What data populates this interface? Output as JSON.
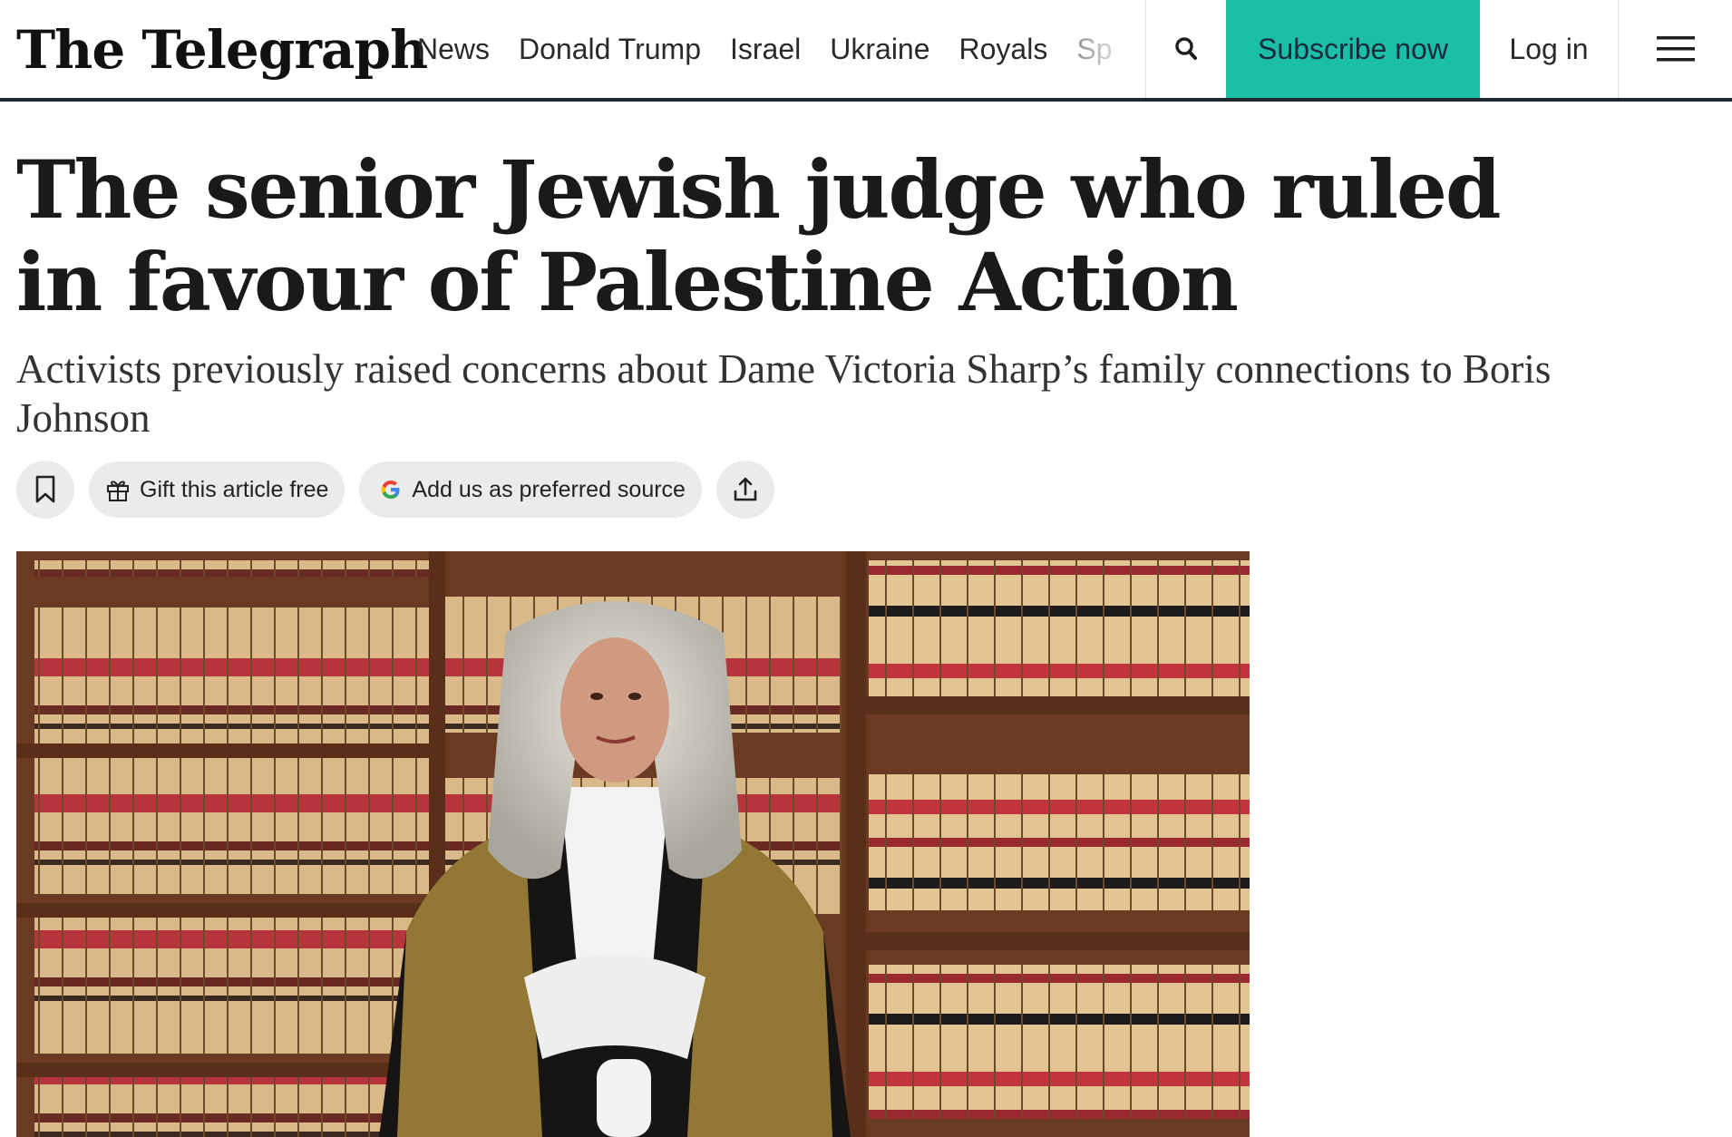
{
  "header": {
    "logo_text": "The Telegraph",
    "nav_items": [
      "News",
      "Donald Trump",
      "Israel",
      "Ukraine",
      "Royals",
      "Sp"
    ],
    "search_icon": "search-icon",
    "subscribe_label": "Subscribe now",
    "login_label": "Log in",
    "menu_icon": "hamburger-menu-icon",
    "accent_color": "#1bbfa8"
  },
  "article": {
    "headline": "The senior Jewish judge who ruled in favour of Palestine Action",
    "standfirst": "Activists previously raised concerns about Dame Victoria Sharp’s family connections to Boris Johnson",
    "actions": {
      "bookmark_icon": "bookmark-icon",
      "gift_icon": "gift-icon",
      "gift_label": "Gift this article free",
      "google_icon": "google-g-icon",
      "preferred_label": "Add us as preferred source",
      "share_icon": "share-icon"
    },
    "hero_image": {
      "subject": "judge-in-wig-and-robes-photo"
    }
  }
}
